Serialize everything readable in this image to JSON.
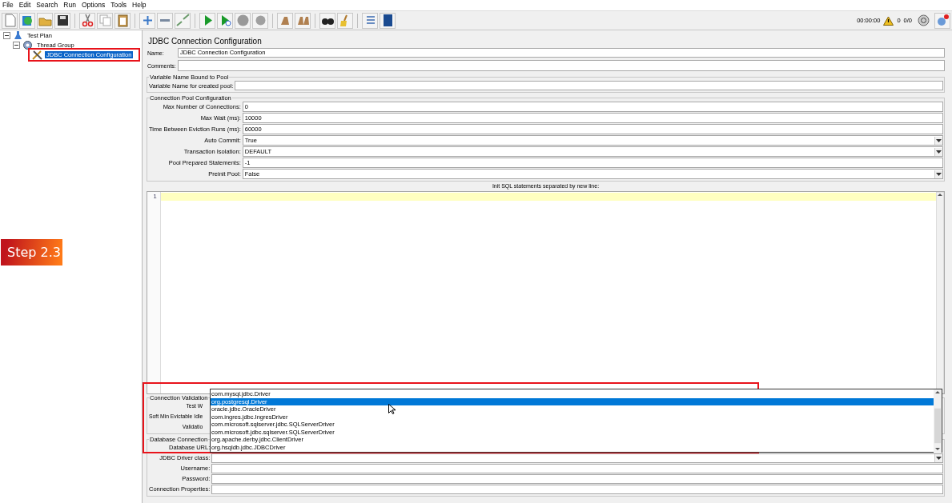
{
  "menu": [
    "File",
    "Edit",
    "Search",
    "Run",
    "Options",
    "Tools",
    "Help"
  ],
  "toolbar": {
    "buttons": [
      {
        "kind": "new"
      },
      {
        "kind": "templates"
      },
      {
        "kind": "open"
      },
      {
        "kind": "save"
      },
      {
        "kind": "sep"
      },
      {
        "kind": "cut"
      },
      {
        "kind": "copy"
      },
      {
        "kind": "paste"
      },
      {
        "kind": "sep"
      },
      {
        "kind": "expand"
      },
      {
        "kind": "collapse"
      },
      {
        "kind": "toggle"
      },
      {
        "kind": "sep"
      },
      {
        "kind": "start"
      },
      {
        "kind": "start-no-pause"
      },
      {
        "kind": "stop"
      },
      {
        "kind": "shutdown"
      },
      {
        "kind": "sep"
      },
      {
        "kind": "clear"
      },
      {
        "kind": "clear-all"
      },
      {
        "kind": "sep"
      },
      {
        "kind": "search"
      },
      {
        "kind": "reset-search"
      },
      {
        "kind": "sep"
      },
      {
        "kind": "function-helper"
      },
      {
        "kind": "help"
      }
    ],
    "elapsed": "00:00:00",
    "warnings": "0",
    "threads": "0/0"
  },
  "tree": [
    {
      "label": "Test Plan",
      "kind": "plan",
      "expanded": true,
      "selected": false,
      "children": [
        {
          "label": "Thread Group",
          "kind": "group",
          "expanded": true,
          "selected": false,
          "children": [
            {
              "label": "JDBC Connection Configuration",
              "kind": "config",
              "selected": true
            }
          ]
        }
      ]
    }
  ],
  "annotation": {
    "label": "Step 2.3"
  },
  "panel": {
    "title": "JDBC Connection Configuration",
    "name": {
      "label": "Name:",
      "value": "JDBC Connection Configuration"
    },
    "comments": {
      "label": "Comments:"
    },
    "sections": [
      {
        "title": "Variable Name Bound to Pool",
        "rows": [
          {
            "label": "Variable Name for created pool:",
            "kind": "text"
          }
        ]
      },
      {
        "title": "Connection Pool Configuration",
        "rows": [
          {
            "label": "Max Number of Connections:",
            "kind": "text",
            "value": "0"
          },
          {
            "label": "Max Wait (ms):",
            "kind": "text",
            "value": "10000"
          },
          {
            "label": "Time Between Eviction Runs (ms):",
            "kind": "text",
            "value": "60000"
          },
          {
            "label": "Auto Commit:",
            "kind": "combo",
            "value": "True"
          },
          {
            "label": "Transaction Isolation:",
            "kind": "combo",
            "value": "DEFAULT"
          },
          {
            "label": "Pool Prepared Statements:",
            "kind": "text",
            "value": "-1"
          },
          {
            "label": "Preinit Pool:",
            "kind": "combo",
            "value": "False"
          }
        ]
      }
    ],
    "editor": {
      "caption": "Init SQL statements separated by new line:",
      "line_numbers": [
        "1"
      ]
    },
    "lower_sections": [
      {
        "title": "Connection Validation",
        "rows": [
          {
            "label": "Test W",
            "kind": "hidden"
          },
          {
            "label": "Soft Min Evictable Idle",
            "kind": "hidden"
          },
          {
            "label": "Validatio",
            "kind": "hidden"
          }
        ]
      },
      {
        "title": "Database Connection",
        "rows": [
          {
            "label": "Database URL:",
            "kind": "hidden"
          },
          {
            "label": "JDBC Driver class:",
            "kind": "combo"
          },
          {
            "label": "Username:",
            "kind": "text"
          },
          {
            "label": "Password:",
            "kind": "text"
          },
          {
            "label": "Connection Properties:",
            "kind": "text"
          }
        ]
      }
    ]
  },
  "dropdown": {
    "options": [
      {
        "label": "com.mysql.jdbc.Driver",
        "selected": false
      },
      {
        "label": "org.postgresql.Driver",
        "selected": true
      },
      {
        "label": "oracle.jdbc.OracleDriver",
        "selected": false
      },
      {
        "label": "com.ingres.jdbc.IngresDriver",
        "selected": false
      },
      {
        "label": "com.microsoft.sqlserver.jdbc.SQLServerDriver",
        "selected": false
      },
      {
        "label": "com.microsoft.jdbc.sqlserver.SQLServerDriver",
        "selected": false
      },
      {
        "label": "org.apache.derby.jdbc.ClientDriver",
        "selected": false
      },
      {
        "label": "org.hsqldb.jdbc.JDBCDriver",
        "selected": false
      }
    ]
  }
}
